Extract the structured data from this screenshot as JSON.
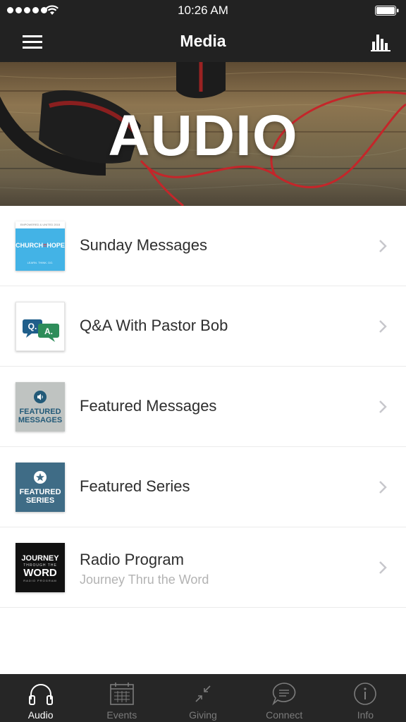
{
  "status_bar": {
    "time": "10:26 AM"
  },
  "nav": {
    "title": "Media",
    "menu_icon": "hamburger-menu-icon",
    "chart_icon": "bar-chart-icon"
  },
  "hero": {
    "title": "AUDIO"
  },
  "items": [
    {
      "title": "Sunday Messages",
      "subtitle": "",
      "thumb": {
        "top": "EMPOWERED & UNITED 2015",
        "word_a": "CHURCH",
        "word_dash": "=",
        "word_b": "HOPE",
        "foot": "LEARN. THINK. DO."
      }
    },
    {
      "title": "Q&A With Pastor Bob",
      "subtitle": "",
      "thumb": {
        "q": "Q.",
        "a": "A."
      }
    },
    {
      "title": "Featured Messages",
      "subtitle": "",
      "thumb": {
        "line1": "FEATURED",
        "line2": "MESSAGES"
      }
    },
    {
      "title": "Featured Series",
      "subtitle": "",
      "thumb": {
        "line1": "FEATURED",
        "line2": "SERIES"
      }
    },
    {
      "title": "Radio Program",
      "subtitle": "Journey Thru the Word",
      "thumb": {
        "line1": "JOURNEY",
        "line2": "THROUGH THE",
        "line3": "WORD",
        "line4": "RADIO PROGRAM"
      }
    }
  ],
  "tabs": [
    {
      "label": "Audio",
      "icon": "headphones-icon",
      "active": true
    },
    {
      "label": "Events",
      "icon": "calendar-icon",
      "active": false
    },
    {
      "label": "Giving",
      "icon": "arrows-in-icon",
      "active": false
    },
    {
      "label": "Connect",
      "icon": "chat-bubble-icon",
      "active": false
    },
    {
      "label": "Info",
      "icon": "info-icon",
      "active": false
    }
  ],
  "colors": {
    "bar_background": "#222222",
    "tab_active": "#ffffff",
    "tab_inactive": "#7b7b7b",
    "row_title": "#2e2e2e",
    "row_subtitle": "#b3b3b3"
  }
}
